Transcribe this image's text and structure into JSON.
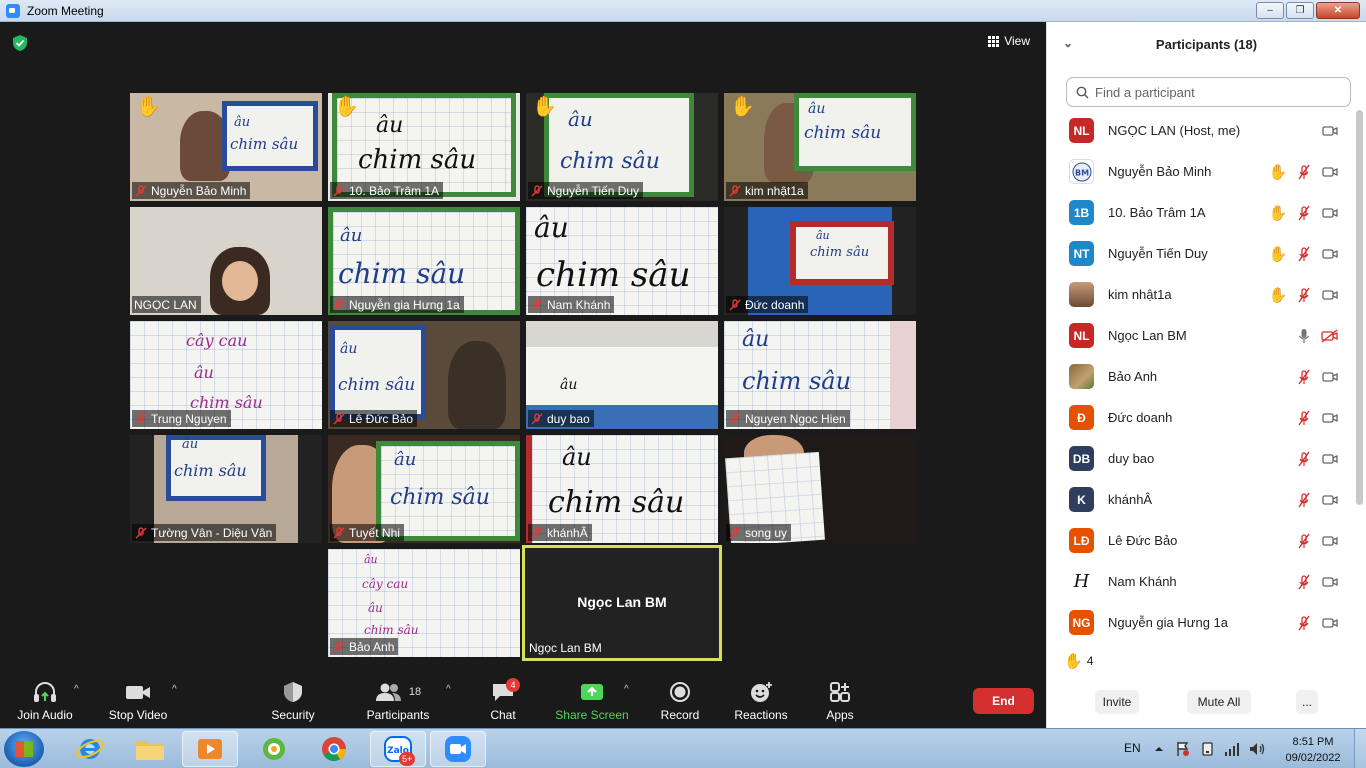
{
  "window": {
    "title": "Zoom Meeting",
    "minimize": "–",
    "restore": "❐",
    "close": "✕"
  },
  "meeting": {
    "view_label": "View",
    "tiles": [
      {
        "name": "Nguyễn Bảo Minh",
        "hand": "raised",
        "board": "âu chim sâu"
      },
      {
        "name": "10.  Bảo Trâm 1A",
        "hand": "raised-light",
        "board": "âu chim sâu"
      },
      {
        "name": "Nguyễn Tiến Duy",
        "hand": "raised",
        "board": "âu chim sâu"
      },
      {
        "name": "kim nhật1a",
        "hand": "raised",
        "board": "âu chim sâu"
      },
      {
        "name": "NGỌC LAN"
      },
      {
        "name": "Nguyễn gia Hưng 1a",
        "board": "âu chim sâu"
      },
      {
        "name": "Nam Khánh",
        "board": "âu chim sâu"
      },
      {
        "name": "Đức doanh",
        "board": "âu chim sâu"
      },
      {
        "name": "Trung Nguyen",
        "board": "cây cau âu chim sâu"
      },
      {
        "name": "Lê Đức Bảo",
        "board": "âu chim sâu"
      },
      {
        "name": "duy bao",
        "board": "âu"
      },
      {
        "name": "Nguyen Ngoc Hien",
        "board": "âu chim sâu"
      },
      {
        "name": "Tường Vân - Diệu Vân",
        "board": "âu chim sâu"
      },
      {
        "name": "Tuyết Nhi",
        "board": "âu chim sâu"
      },
      {
        "name": "khánhÂ",
        "board": "âu chim sâu"
      },
      {
        "name": "song uy"
      },
      {
        "name": "Bảo Anh",
        "board": "âu cây cau âu chim sâu"
      },
      {
        "name": "Ngọc Lan BM",
        "center_name": "Ngọc Lan BM",
        "active": true
      }
    ]
  },
  "toolbar": {
    "join_audio": "Join Audio",
    "stop_video": "Stop Video",
    "security": "Security",
    "participants": "Participants",
    "participants_count": "18",
    "chat": "Chat",
    "chat_badge": "4",
    "share_screen": "Share Screen",
    "record": "Record",
    "reactions": "Reactions",
    "apps": "Apps",
    "end": "End"
  },
  "panel": {
    "title": "Participants (18)",
    "search_placeholder": "Find a participant",
    "participants": [
      {
        "initials": "NL",
        "color": "#c62828",
        "name": "NGỌC LAN (Host, me)",
        "hand": "",
        "mic": "none",
        "video": "on"
      },
      {
        "initials": "BM",
        "color": "#ffffff",
        "name": "Nguyễn Bảo Minh",
        "hand": "raised",
        "mic": "muted",
        "video": "on",
        "logo": true
      },
      {
        "initials": "1B",
        "color": "#1e88c8",
        "name": "10.  Bảo Trâm 1A",
        "hand": "raised-light",
        "mic": "muted",
        "video": "on"
      },
      {
        "initials": "NT",
        "color": "#1e88c8",
        "name": "Nguyễn Tiến Duy",
        "hand": "raised",
        "mic": "muted",
        "video": "on"
      },
      {
        "initials": "",
        "color": "#a86a4a",
        "name": "kim nhật1a",
        "hand": "raised",
        "mic": "muted",
        "video": "on",
        "photo": true
      },
      {
        "initials": "NL",
        "color": "#c62828",
        "name": "Ngọc Lan BM",
        "hand": "",
        "mic": "on",
        "video": "off"
      },
      {
        "initials": "",
        "color": "#8a6a3a",
        "name": "Bảo Anh",
        "hand": "",
        "mic": "muted",
        "video": "on",
        "photo": true
      },
      {
        "initials": "Đ",
        "color": "#e65100",
        "name": "Đức doanh",
        "hand": "",
        "mic": "muted",
        "video": "on"
      },
      {
        "initials": "DB",
        "color": "#2f3e5c",
        "name": "duy bao",
        "hand": "",
        "mic": "muted",
        "video": "on"
      },
      {
        "initials": "K",
        "color": "#2f3e5c",
        "name": "khánhÂ",
        "hand": "",
        "mic": "muted",
        "video": "on"
      },
      {
        "initials": "LĐ",
        "color": "#e65100",
        "name": "Lê Đức Bảo",
        "hand": "",
        "mic": "muted",
        "video": "on"
      },
      {
        "initials": "H",
        "color": "#ffffff",
        "name": "Nam Khánh",
        "hand": "",
        "mic": "muted",
        "video": "on",
        "script": true
      },
      {
        "initials": "NG",
        "color": "#e65100",
        "name": "Nguyễn gia Hưng 1a",
        "hand": "",
        "mic": "muted",
        "video": "on"
      }
    ],
    "raised_hands_count": "4",
    "invite": "Invite",
    "mute_all": "Mute All",
    "more": "..."
  },
  "taskbar": {
    "language": "EN",
    "time": "8:51 PM",
    "date": "09/02/2022",
    "zalo_badge": "5+",
    "zalo_label": "Zalo"
  }
}
